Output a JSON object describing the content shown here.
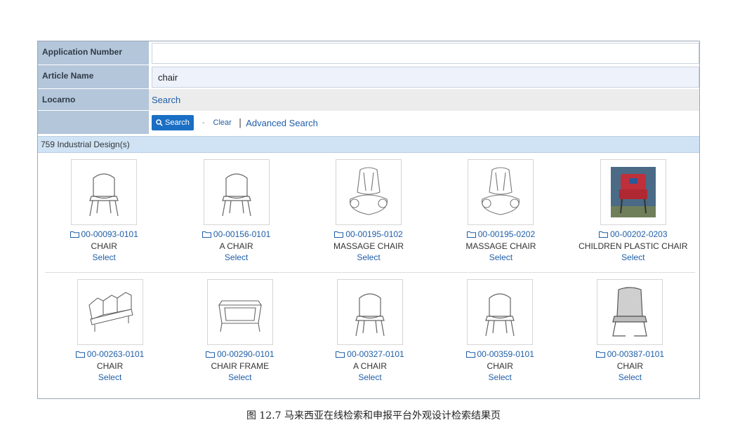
{
  "form": {
    "application_number": {
      "label": "Application Number",
      "value": ""
    },
    "article_name": {
      "label": "Article Name",
      "value": "chair"
    },
    "locarno": {
      "label": "Locarno",
      "link": "Search"
    },
    "actions": {
      "search": "Search",
      "separator": "-",
      "clear": "Clear",
      "pipe": "|",
      "advanced": "Advanced Search"
    }
  },
  "results": {
    "count_text": "759 Industrial Design(s)",
    "items": [
      {
        "number": "00-00093-0101",
        "name": "CHAIR",
        "select": "Select",
        "image": "chair-sketch"
      },
      {
        "number": "00-00156-0101",
        "name": "A CHAIR",
        "select": "Select",
        "image": "chair-sketch"
      },
      {
        "number": "00-00195-0102",
        "name": "MASSAGE CHAIR",
        "select": "Select",
        "image": "massage-chair-sketch"
      },
      {
        "number": "00-00195-0202",
        "name": "MASSAGE CHAIR",
        "select": "Select",
        "image": "massage-chair-sketch"
      },
      {
        "number": "00-00202-0203",
        "name": "CHILDREN PLASTIC CHAIR",
        "select": "Select",
        "image": "red-chair-photo"
      },
      {
        "number": "00-00263-0101",
        "name": "CHAIR",
        "select": "Select",
        "image": "bench-chair-sketch"
      },
      {
        "number": "00-00290-0101",
        "name": "CHAIR FRAME",
        "select": "Select",
        "image": "chair-frame-sketch"
      },
      {
        "number": "00-00327-0101",
        "name": "A CHAIR",
        "select": "Select",
        "image": "chair-sketch"
      },
      {
        "number": "00-00359-0101",
        "name": "CHAIR",
        "select": "Select",
        "image": "chair-sketch"
      },
      {
        "number": "00-00387-0101",
        "name": "CHAIR",
        "select": "Select",
        "image": "mesh-chair-sketch"
      }
    ]
  },
  "caption": "图 12.7  马来西亚在线检索和申报平台外观设计检索结果页",
  "colors": {
    "label_bg": "#b3c6da",
    "link": "#1f5ea8",
    "button": "#1a6fc4",
    "result_bar": "#cfe3f5"
  }
}
